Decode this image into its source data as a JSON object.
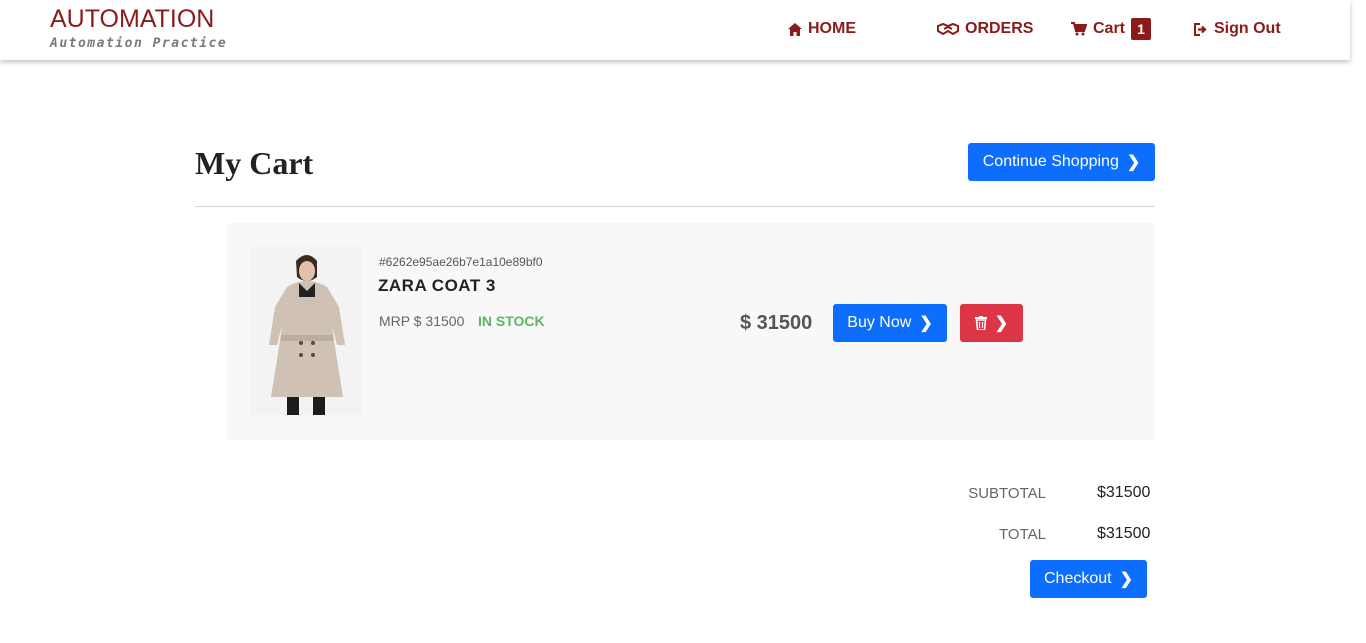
{
  "brand": {
    "title": "AUTOMATION",
    "subtitle": "Automation Practice"
  },
  "nav": {
    "home": "HOME",
    "orders": "ORDERS",
    "cart": "Cart",
    "cart_count": "1",
    "sign_out": "Sign Out"
  },
  "page": {
    "title": "My Cart",
    "continue_label": "Continue Shopping"
  },
  "item": {
    "id": "#6262e95ae26b7e1a10e89bf0",
    "name": "ZARA COAT 3",
    "mrp": "MRP $ 31500",
    "stock": "IN STOCK",
    "price": "$ 31500",
    "buy_label": "Buy Now"
  },
  "summary": {
    "subtotal_label": "SUBTOTAL",
    "subtotal_value": "$31500",
    "total_label": "TOTAL",
    "total_value": "$31500",
    "checkout_label": "Checkout"
  },
  "colors": {
    "brand": "#8b1a1a",
    "primary": "#0d6efd",
    "danger": "#dc3545",
    "stock": "#5cb85c"
  }
}
